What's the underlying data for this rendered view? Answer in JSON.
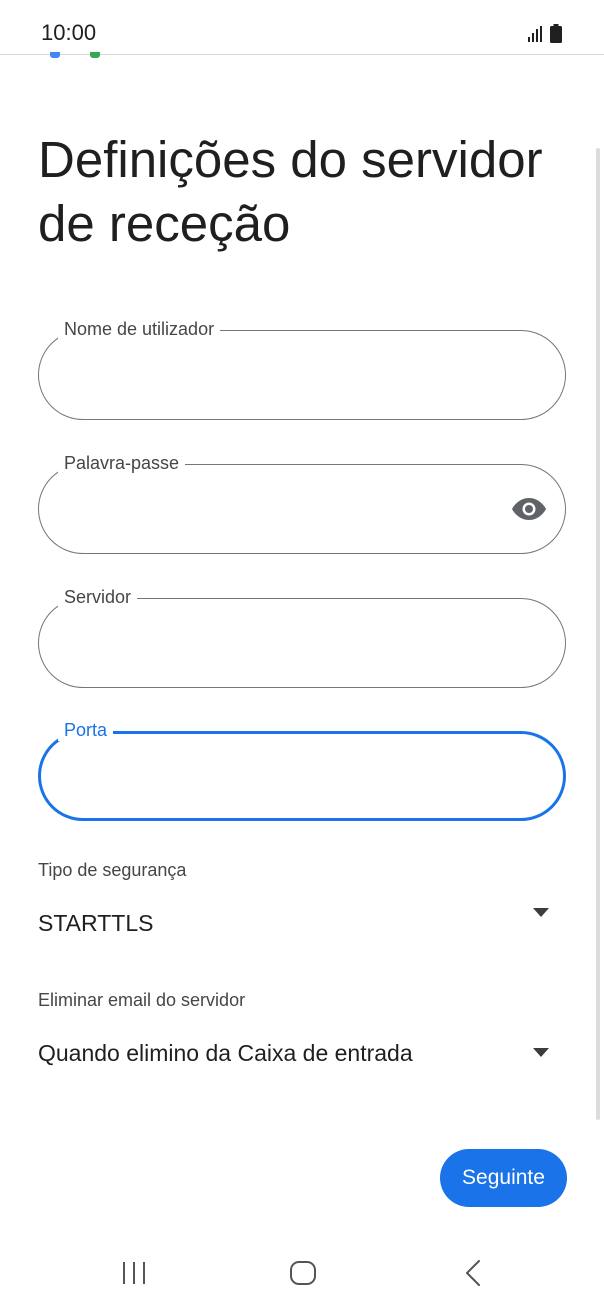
{
  "status_bar": {
    "time": "10:00",
    "icons": [
      "signal-icon",
      "battery-icon"
    ]
  },
  "page": {
    "title": "Definições do servidor de receção"
  },
  "form": {
    "username": {
      "label": "Nome de utilizador",
      "value": ""
    },
    "password": {
      "label": "Palavra-passe",
      "value": "",
      "toggle_icon": "eye-icon"
    },
    "server": {
      "label": "Servidor",
      "value": ""
    },
    "port": {
      "label": "Porta",
      "value": "",
      "focused": true
    }
  },
  "security_type": {
    "label": "Tipo de segurança",
    "selected": "STARTTLS",
    "icon": "caret-down-icon"
  },
  "delete_email": {
    "label": "Eliminar email do servidor",
    "selected": "Quando elimino da Caixa de entrada",
    "icon": "caret-down-icon"
  },
  "actions": {
    "next_label": "Seguinte"
  },
  "navigation": {
    "icons": [
      "recent-apps-icon",
      "home-icon",
      "back-icon"
    ]
  },
  "colors": {
    "accent": "#1a73e8",
    "outline": "#747775",
    "text": "#1f1f1f",
    "secondary_text": "#444746"
  }
}
